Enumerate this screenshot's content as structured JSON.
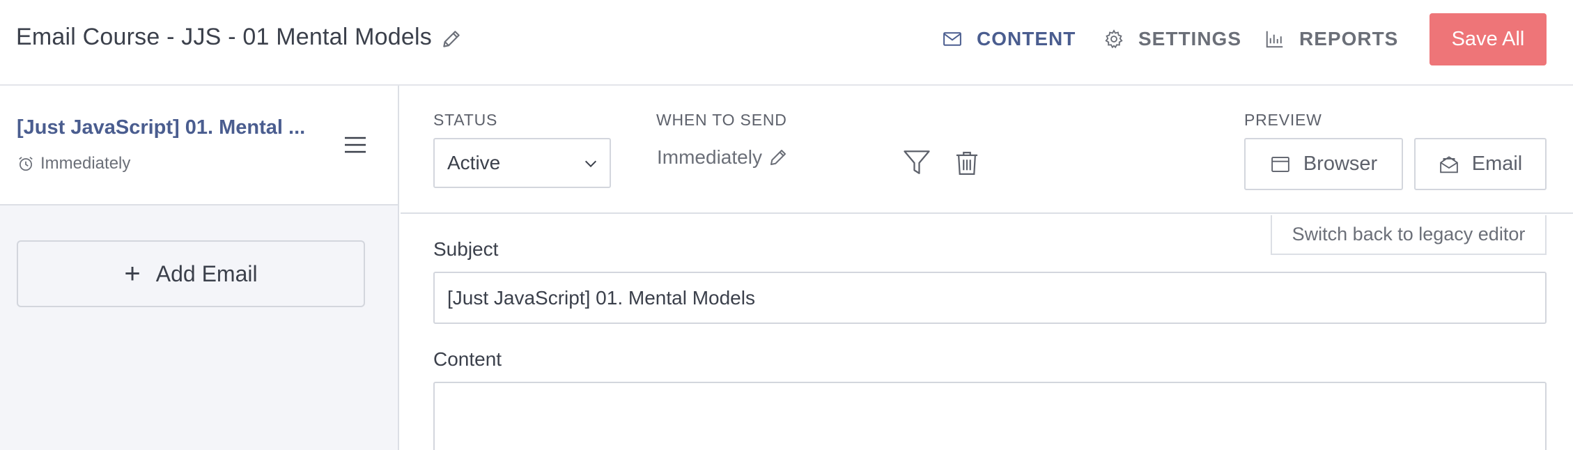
{
  "header": {
    "title": "Email Course - JJS - 01 Mental Models",
    "nav": {
      "content": "CONTENT",
      "settings": "SETTINGS",
      "reports": "REPORTS"
    },
    "save_label": "Save All"
  },
  "sidebar": {
    "email_title": "[Just JavaScript] 01. Mental ...",
    "email_schedule": "Immediately",
    "add_email_label": "Add Email"
  },
  "settings": {
    "status_label": "STATUS",
    "status_value": "Active",
    "when_label": "WHEN TO SEND",
    "when_value": "Immediately",
    "preview_label": "PREVIEW",
    "browser_label": "Browser",
    "email_label": "Email"
  },
  "editor": {
    "legacy_label": "Switch back to legacy editor",
    "subject_label": "Subject",
    "subject_value": "[Just JavaScript] 01. Mental Models",
    "content_label": "Content"
  },
  "colors": {
    "accent": "#4a5d8f",
    "save": "#ee7578",
    "sidebar_bg": "#f4f5f9"
  }
}
